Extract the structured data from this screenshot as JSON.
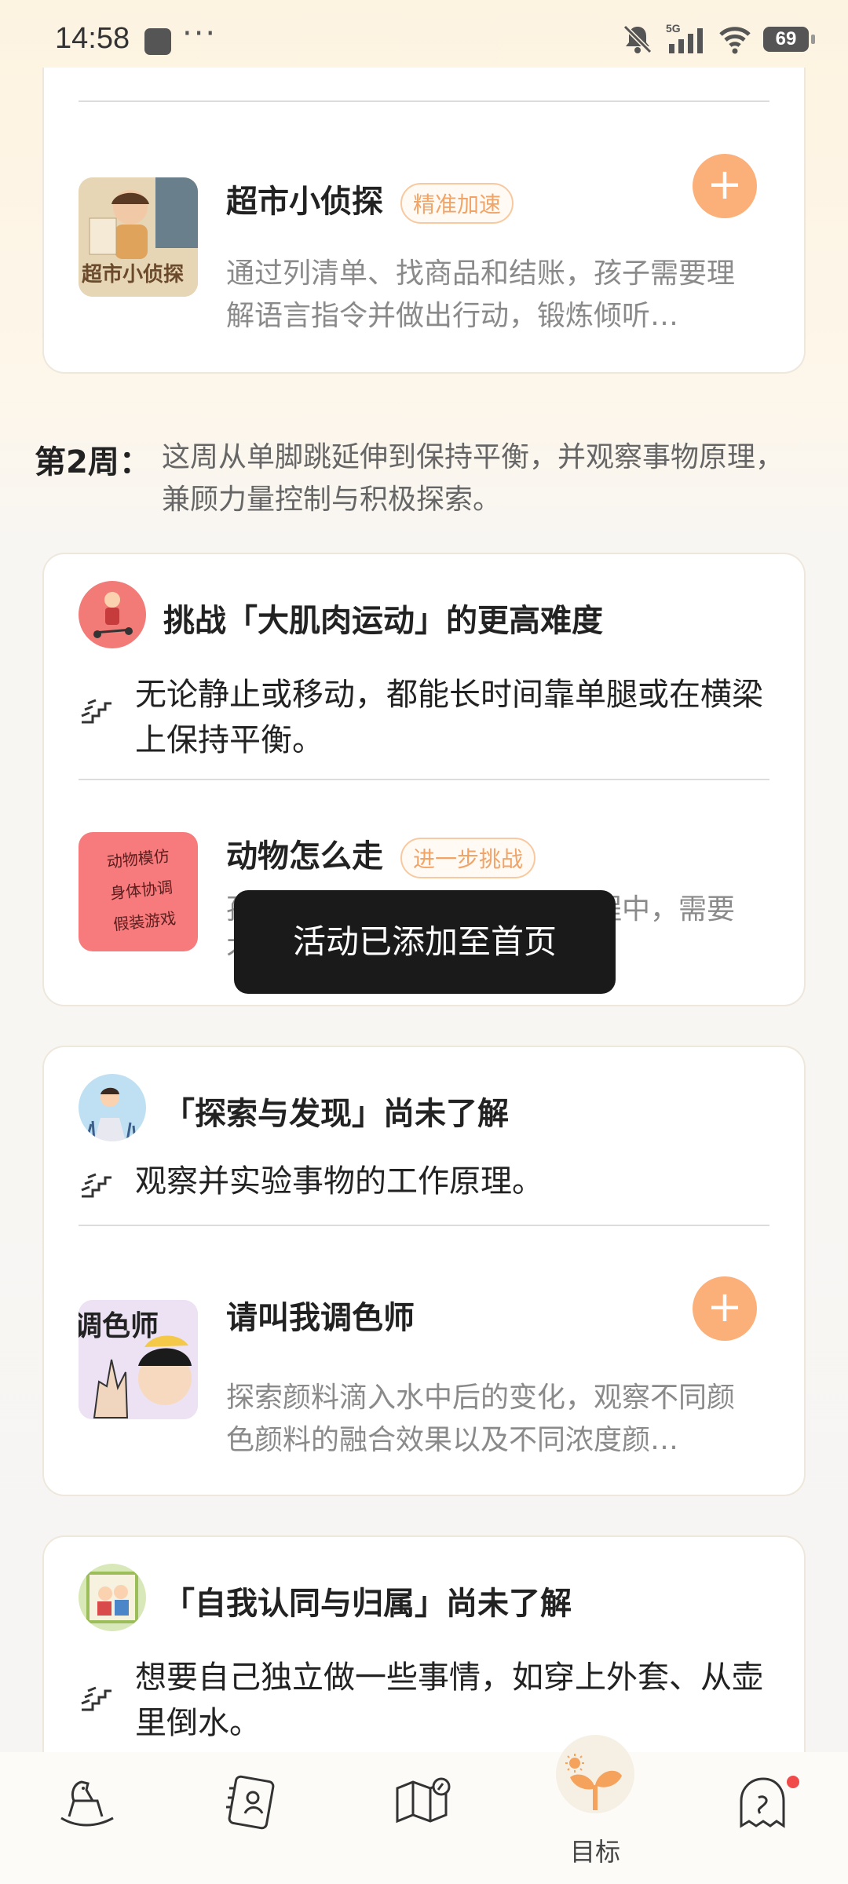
{
  "status_bar": {
    "time": "14:58",
    "dots": "···",
    "network": "5G",
    "battery": "69"
  },
  "card1": {
    "activity": {
      "title": "超市小侦探",
      "tag": "精准加速",
      "desc": "通过列清单、找商品和结账，孩子需要理解语言指令并做出行动，锻炼倾听…",
      "thumb_text": "超市小侦探",
      "add_label": "+"
    }
  },
  "week2": {
    "label": "第2周：",
    "desc": "这周从单脚跳延伸到保持平衡，并观察事物原理，兼顾力量控制与积极探索。"
  },
  "card2": {
    "title": "挑战「大肌肉运动」的更高难度",
    "goal": "无论静止或移动，都能长时间靠单腿或在横梁上保持平衡。",
    "activity": {
      "title": "动物怎么走",
      "tag": "进一步挑战",
      "desc": "孩子在模仿不同动物走路的过程中，需要不断调整身体动作、移动速…",
      "thumb_lines": [
        "动物模仿",
        "身体协调",
        "假装游戏"
      ]
    }
  },
  "card3": {
    "title": "「探索与发现」尚未了解",
    "goal": "观察并实验事物的工作原理。",
    "activity": {
      "title": "请叫我调色师",
      "desc": "探索颜料滴入水中后的变化，观察不同颜色颜料的融合效果以及不同浓度颜…",
      "thumb_text": "调色师",
      "add_label": "+"
    }
  },
  "card4": {
    "title": "「自我认同与归属」尚未了解",
    "goal": "想要自己独立做一些事情，如穿上外套、从壶里倒水。"
  },
  "toast": "活动已添加至首页",
  "tabbar": {
    "tabs": [
      {
        "icon": "rocking-horse-icon"
      },
      {
        "icon": "baby-notebook-icon"
      },
      {
        "icon": "map-icon"
      },
      {
        "icon": "sprout-icon",
        "label": "目标"
      },
      {
        "icon": "ghost-icon"
      }
    ],
    "accent": "#f5a25d"
  }
}
